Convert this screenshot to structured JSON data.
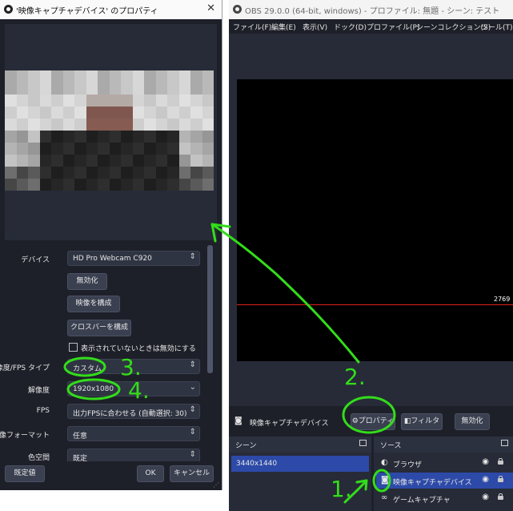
{
  "dialog": {
    "title": "'映像キャプチャデバイス' のプロパティ",
    "close_glyph": "✕",
    "properties": [
      {
        "label": "デバイス",
        "value": "HD Pro Webcam C920",
        "type": "select"
      },
      {
        "label": "解像度/FPS タイプ",
        "value": "カスタム",
        "type": "select"
      },
      {
        "label": "解像度",
        "value": "1920x1080",
        "type": "select-editable"
      },
      {
        "label": "FPS",
        "value": "出力FPSに合わせる (自動選択: 30)",
        "type": "select"
      },
      {
        "label": "映像フォーマット",
        "value": "任意",
        "type": "select"
      },
      {
        "label": "色空間",
        "value": "既定",
        "type": "select"
      }
    ],
    "buttons": {
      "deactivate": "無効化",
      "configure_video": "映像を構成",
      "configure_crossbar": "クロスバーを構成"
    },
    "checkbox_label": "表示されていないときは無効にする",
    "footer": {
      "defaults": "既定値",
      "ok": "OK",
      "cancel": "キャンセル"
    }
  },
  "obs": {
    "title": "OBS 29.0.0 (64-bit, windows) - プロファイル: 無題 - シーン: テスト",
    "menu": [
      "ファイル(F)",
      "編集(E)",
      "表示(V)",
      "ドック(D)",
      "プロファイル(P)",
      "シーンコレクション(S)",
      "ツール(T)"
    ],
    "canvas_value": "2769",
    "source_toolbar": {
      "selected_source": "映像キャプチャデバイス",
      "properties": "プロパティ",
      "filters": "フィルタ",
      "deactivate": "無効化"
    },
    "scenes": {
      "title": "シーン",
      "items": [
        "3440x1440"
      ]
    },
    "sources": {
      "title": "ソース",
      "items": [
        {
          "name": "ブラウザ",
          "icon": "globe-icon"
        },
        {
          "name": "映像キャプチャデバイス",
          "icon": "camera-icon",
          "selected": true
        },
        {
          "name": "ゲームキャプチャ",
          "icon": "gamepad-icon"
        }
      ]
    }
  },
  "annotations": {
    "step1": "1.",
    "step2": "2.",
    "step3": "3.",
    "step4": "4."
  },
  "colors": {
    "annotation": "#33dd1a",
    "selected": "#2d4aa8",
    "redline": "#e0201a"
  }
}
